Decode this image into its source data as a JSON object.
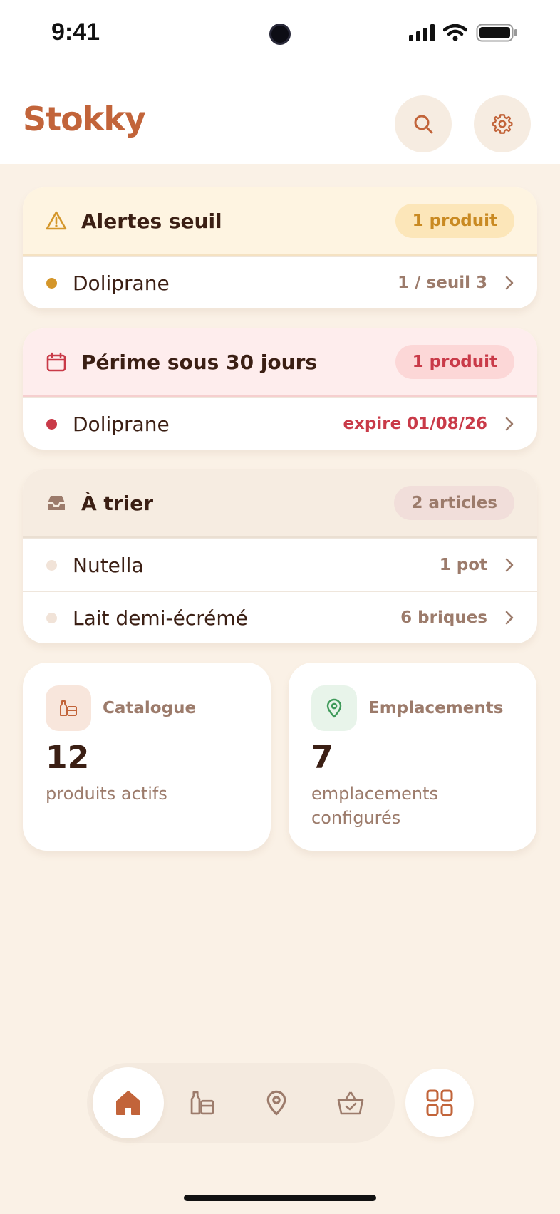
{
  "status_bar": {
    "time": "9:41"
  },
  "header": {
    "title": "Stokky"
  },
  "colors": {
    "accent": "#C2643A",
    "warning": "#D4962A",
    "danger": "#C93A48",
    "neutral": "#9C7B6B",
    "background": "#FAF1E6"
  },
  "alerts": {
    "title": "Alertes seuil",
    "badge": "1 produit",
    "items": [
      {
        "name": "Doliprane",
        "meta": "1 / seuil 3"
      }
    ]
  },
  "expiring": {
    "title": "Périme sous 30 jours",
    "badge": "1 produit",
    "items": [
      {
        "name": "Doliprane",
        "meta": "expire 01/08/26"
      }
    ]
  },
  "to_sort": {
    "title": "À trier",
    "badge": "2 articles",
    "items": [
      {
        "name": "Nutella",
        "meta": "1 pot"
      },
      {
        "name": "Lait demi-écrémé",
        "meta": "6 briques"
      }
    ]
  },
  "stats": {
    "catalogue": {
      "label": "Catalogue",
      "value": "12",
      "sub": "produits actifs"
    },
    "locations": {
      "label": "Emplacements",
      "value": "7",
      "sub_line1": "emplacements",
      "sub_line2": "configurés"
    }
  },
  "nav": {
    "items": [
      "home-icon",
      "products-icon",
      "location-icon",
      "basket-icon"
    ],
    "active": "home-icon",
    "extra": "grid-icon"
  }
}
